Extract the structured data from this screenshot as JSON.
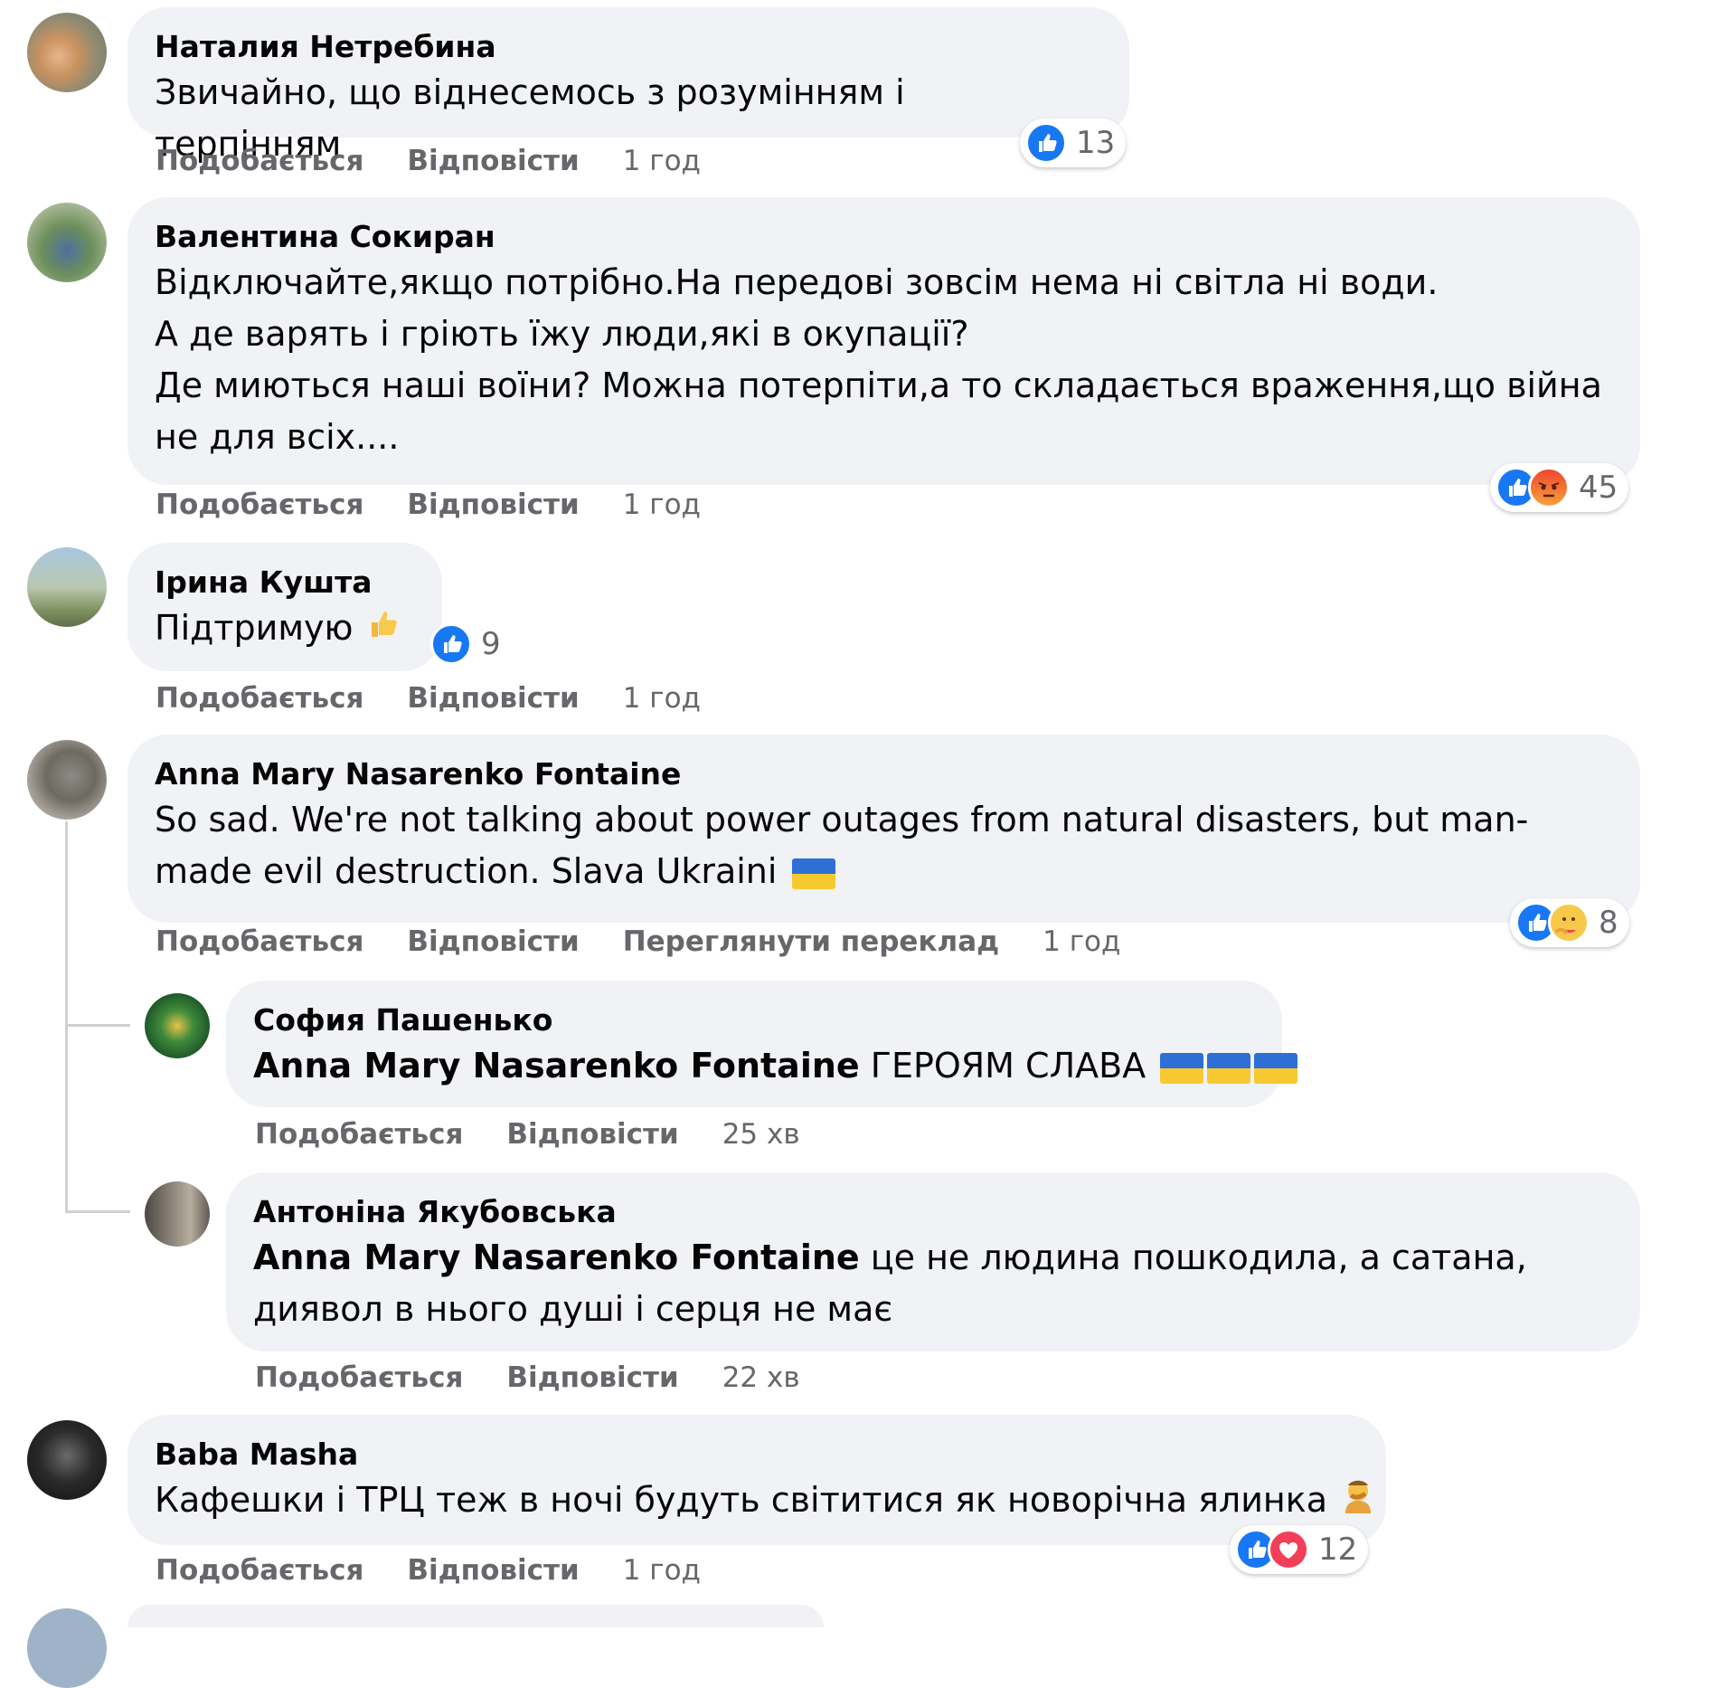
{
  "actions": {
    "like_label": "Подобається",
    "reply_label": "Відповісти",
    "translate_label": "Переглянути переклад"
  },
  "colors": {
    "bubble_bg": "#f0f2f5",
    "meta_text": "#65676b",
    "like_blue": "#1877f2",
    "angry_orange": "#e9710f",
    "love_red": "#f33e58"
  },
  "comments": [
    {
      "author": "Наталия Нетребина",
      "text": "Звичайно, що віднесемось з розумінням і терпінням",
      "time": "1 год",
      "reactions": [
        "like"
      ],
      "reaction_count": "13"
    },
    {
      "author": "Валентина Сокиран",
      "text": "Відключайте,якщо потрібно.На передові зовсім нема ні світла ні води.\nА де варять і гріють їжу люди,які в окупації?\nДе миються наші воїни? Можна потерпіти,а то складається враження,що війна не для всіх....",
      "time": "1 год",
      "reactions": [
        "like",
        "angry"
      ],
      "reaction_count": "45"
    },
    {
      "author": "Ірина Кушта",
      "text": "Підтримую",
      "emoji": "thumbs-up-emoji",
      "time": "1 год",
      "reactions": [
        "like"
      ],
      "reaction_count": "9"
    },
    {
      "author": "Anna Mary Nasarenko Fontaine",
      "text": "So sad. We're not talking about power outages from natural disasters, but man-made evil destruction. Slava Ukraini",
      "emoji": "ukraine-flag",
      "time": "1 год",
      "reactions": [
        "like",
        "care"
      ],
      "reaction_count": "8"
    },
    {
      "author": "Baba Masha",
      "text": "Кафешки і ТРЦ теж в ночі будуть світитися як новорічна ялинка",
      "emoji": "facepalm-emoji",
      "time": "1 год",
      "reactions": [
        "like",
        "love"
      ],
      "reaction_count": "12"
    }
  ],
  "replies": [
    {
      "author": "София Пашенько",
      "mention": "Anna Mary Nasarenko Fontaine",
      "text": " ГЕРОЯМ СЛАВА",
      "emoji": "ukraine-flag x3",
      "time": "25 хв"
    },
    {
      "author": "Антоніна Якубовська",
      "mention": "Anna Mary Nasarenko Fontaine",
      "text": " це не людина пошкодила, а сатана, диявол в нього душі і серця не має",
      "time": "22 хв"
    }
  ]
}
